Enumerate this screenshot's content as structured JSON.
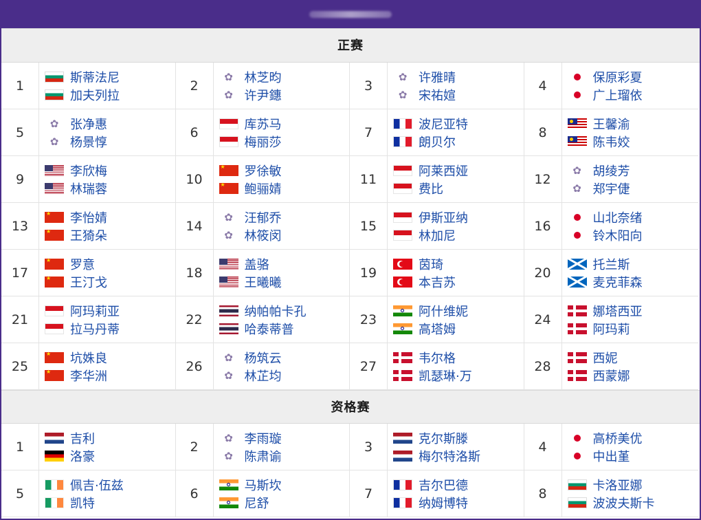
{
  "sections": [
    {
      "title": "正赛",
      "entries": [
        {
          "seed": "1",
          "players": [
            {
              "name": "斯蒂法尼",
              "flag": "flag-bulgaria"
            },
            {
              "name": "加夫列拉",
              "flag": "flag-bulgaria"
            }
          ]
        },
        {
          "seed": "2",
          "players": [
            {
              "name": "林芝昀",
              "flag": "flag-tpe-plum"
            },
            {
              "name": "许尹鏸",
              "flag": "flag-tpe-plum"
            }
          ]
        },
        {
          "seed": "3",
          "players": [
            {
              "name": "许雅晴",
              "flag": "flag-tpe-plum"
            },
            {
              "name": "宋祐媗",
              "flag": "flag-tpe-plum"
            }
          ]
        },
        {
          "seed": "4",
          "players": [
            {
              "name": "保原彩夏",
              "flag": "flag-japan"
            },
            {
              "name": "广上瑠依",
              "flag": "flag-japan"
            }
          ]
        },
        {
          "seed": "5",
          "players": [
            {
              "name": "张净惠",
              "flag": "flag-tpe-plum"
            },
            {
              "name": "杨景惇",
              "flag": "flag-tpe-plum"
            }
          ]
        },
        {
          "seed": "6",
          "players": [
            {
              "name": "库苏马",
              "flag": "flag-indonesia"
            },
            {
              "name": "梅丽莎",
              "flag": "flag-indonesia"
            }
          ]
        },
        {
          "seed": "7",
          "players": [
            {
              "name": "波尼亚特",
              "flag": "flag-france"
            },
            {
              "name": "朗贝尔",
              "flag": "flag-france"
            }
          ]
        },
        {
          "seed": "8",
          "players": [
            {
              "name": "王馨渝",
              "flag": "flag-malaysia"
            },
            {
              "name": "陈韦姣",
              "flag": "flag-malaysia"
            }
          ]
        },
        {
          "seed": "9",
          "players": [
            {
              "name": "李欣梅",
              "flag": "flag-usa"
            },
            {
              "name": "林瑞蓉",
              "flag": "flag-usa"
            }
          ]
        },
        {
          "seed": "10",
          "players": [
            {
              "name": "罗徐敏",
              "flag": "flag-china"
            },
            {
              "name": "鲍骊婧",
              "flag": "flag-china"
            }
          ]
        },
        {
          "seed": "11",
          "players": [
            {
              "name": "阿莱西娅",
              "flag": "flag-indonesia"
            },
            {
              "name": "费比",
              "flag": "flag-indonesia"
            }
          ]
        },
        {
          "seed": "12",
          "players": [
            {
              "name": "胡绫芳",
              "flag": "flag-tpe-plum"
            },
            {
              "name": "郑宇倢",
              "flag": "flag-tpe-plum"
            }
          ]
        },
        {
          "seed": "13",
          "players": [
            {
              "name": "李怡婧",
              "flag": "flag-china"
            },
            {
              "name": "王猗朵",
              "flag": "flag-china"
            }
          ]
        },
        {
          "seed": "14",
          "players": [
            {
              "name": "汪郁乔",
              "flag": "flag-tpe-plum"
            },
            {
              "name": "林筱闵",
              "flag": "flag-tpe-plum"
            }
          ]
        },
        {
          "seed": "15",
          "players": [
            {
              "name": "伊斯亚纳",
              "flag": "flag-indonesia"
            },
            {
              "name": "林加尼",
              "flag": "flag-indonesia"
            }
          ]
        },
        {
          "seed": "16",
          "players": [
            {
              "name": "山北奈绪",
              "flag": "flag-japan"
            },
            {
              "name": "铃木阳向",
              "flag": "flag-japan"
            }
          ]
        },
        {
          "seed": "17",
          "players": [
            {
              "name": "罗意",
              "flag": "flag-china"
            },
            {
              "name": "王汀戈",
              "flag": "flag-china"
            }
          ]
        },
        {
          "seed": "18",
          "players": [
            {
              "name": "盖骆",
              "flag": "flag-usa"
            },
            {
              "name": "王曦曦",
              "flag": "flag-usa"
            }
          ]
        },
        {
          "seed": "19",
          "players": [
            {
              "name": "茵琦",
              "flag": "flag-turkey"
            },
            {
              "name": "本吉苏",
              "flag": "flag-turkey"
            }
          ]
        },
        {
          "seed": "20",
          "players": [
            {
              "name": "托兰斯",
              "flag": "flag-scotland"
            },
            {
              "name": "麦克菲森",
              "flag": "flag-scotland"
            }
          ]
        },
        {
          "seed": "21",
          "players": [
            {
              "name": "阿玛莉亚",
              "flag": "flag-indonesia"
            },
            {
              "name": "拉马丹蒂",
              "flag": "flag-indonesia"
            }
          ]
        },
        {
          "seed": "22",
          "players": [
            {
              "name": "纳帕帕卡孔",
              "flag": "flag-thailand"
            },
            {
              "name": "哈泰蒂普",
              "flag": "flag-thailand"
            }
          ]
        },
        {
          "seed": "23",
          "players": [
            {
              "name": "阿什维妮",
              "flag": "flag-india"
            },
            {
              "name": "高塔姆",
              "flag": "flag-india"
            }
          ]
        },
        {
          "seed": "24",
          "players": [
            {
              "name": "娜塔西亚",
              "flag": "flag-denmark"
            },
            {
              "name": "阿玛莉",
              "flag": "flag-denmark"
            }
          ]
        },
        {
          "seed": "25",
          "players": [
            {
              "name": "坑姝良",
              "flag": "flag-china"
            },
            {
              "name": "李华洲",
              "flag": "flag-china"
            }
          ]
        },
        {
          "seed": "26",
          "players": [
            {
              "name": "杨筑云",
              "flag": "flag-tpe-plum"
            },
            {
              "name": "林芷均",
              "flag": "flag-tpe-plum"
            }
          ]
        },
        {
          "seed": "27",
          "players": [
            {
              "name": "韦尔格",
              "flag": "flag-denmark"
            },
            {
              "name": "凯瑟琳·万",
              "flag": "flag-denmark"
            }
          ]
        },
        {
          "seed": "28",
          "players": [
            {
              "name": "西妮",
              "flag": "flag-denmark"
            },
            {
              "name": "西蒙娜",
              "flag": "flag-denmark"
            }
          ]
        }
      ]
    },
    {
      "title": "资格赛",
      "entries": [
        {
          "seed": "1",
          "players": [
            {
              "name": "吉利",
              "flag": "flag-netherlands"
            },
            {
              "name": "洛豪",
              "flag": "flag-germany"
            }
          ]
        },
        {
          "seed": "2",
          "players": [
            {
              "name": "李雨璇",
              "flag": "flag-tpe-plum"
            },
            {
              "name": "陈肃谕",
              "flag": "flag-tpe-plum"
            }
          ]
        },
        {
          "seed": "3",
          "players": [
            {
              "name": "克尔斯滕",
              "flag": "flag-netherlands"
            },
            {
              "name": "梅尔特洛斯",
              "flag": "flag-netherlands"
            }
          ]
        },
        {
          "seed": "4",
          "players": [
            {
              "name": "高桥美优",
              "flag": "flag-japan"
            },
            {
              "name": "中出堇",
              "flag": "flag-japan"
            }
          ]
        },
        {
          "seed": "5",
          "players": [
            {
              "name": "佩吉·伍兹",
              "flag": "flag-ireland"
            },
            {
              "name": "凯特",
              "flag": "flag-ireland"
            }
          ]
        },
        {
          "seed": "6",
          "players": [
            {
              "name": "马斯坎",
              "flag": "flag-india"
            },
            {
              "name": "尼舒",
              "flag": "flag-india"
            }
          ]
        },
        {
          "seed": "7",
          "players": [
            {
              "name": "吉尔巴德",
              "flag": "flag-france"
            },
            {
              "name": "纳姆博特",
              "flag": "flag-france"
            }
          ]
        },
        {
          "seed": "8",
          "players": [
            {
              "name": "卡洛亚娜",
              "flag": "flag-bulgaria"
            },
            {
              "name": "波波夫斯卡",
              "flag": "flag-bulgaria"
            }
          ]
        }
      ]
    }
  ]
}
